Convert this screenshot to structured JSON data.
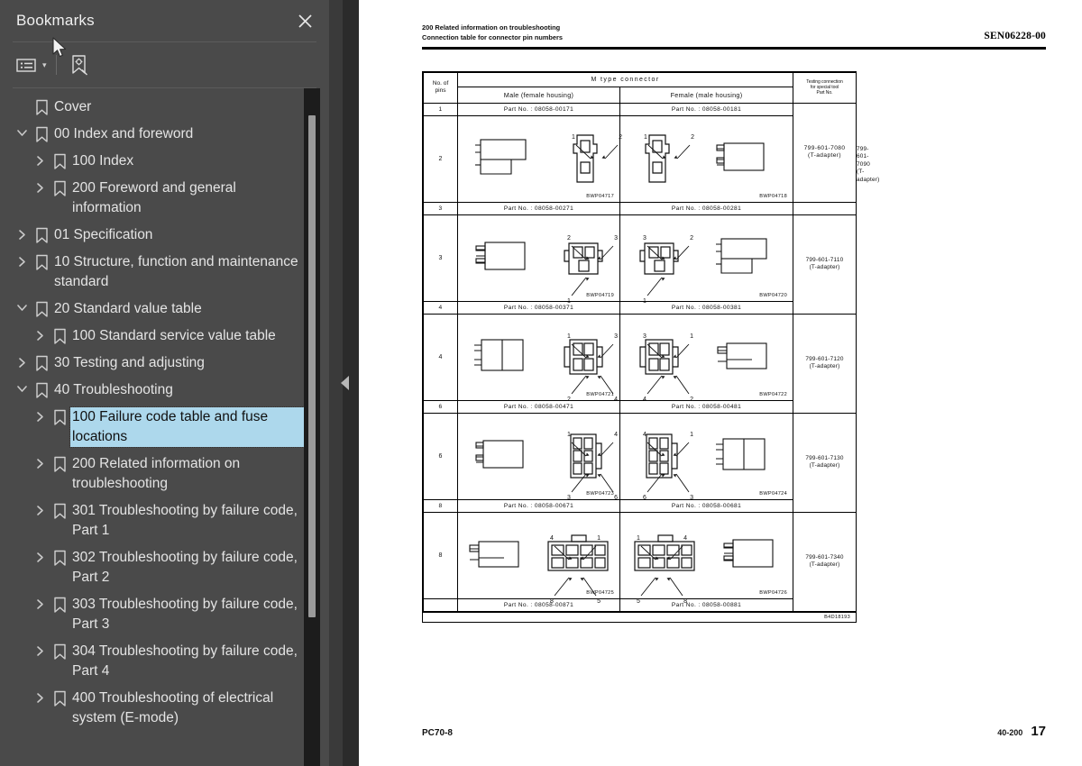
{
  "sidebar": {
    "title": "Bookmarks",
    "close_icon": "close-icon",
    "toolbar": {
      "list_options_icon": "list-options-icon",
      "list_options_caret": "▾",
      "new_bookmark_icon": "new-bookmark-icon"
    },
    "items": [
      {
        "label": "Cover",
        "level": 0,
        "expander": "none",
        "selected": false
      },
      {
        "label": "00 Index and foreword",
        "level": 0,
        "expander": "expanded",
        "selected": false
      },
      {
        "label": "100 Index",
        "level": 1,
        "expander": "collapsed",
        "selected": false
      },
      {
        "label": "200 Foreword and general information",
        "level": 1,
        "expander": "collapsed",
        "selected": false
      },
      {
        "label": "01 Specification",
        "level": 0,
        "expander": "collapsed",
        "selected": false
      },
      {
        "label": "10 Structure, function and maintenance standard",
        "level": 0,
        "expander": "collapsed",
        "selected": false
      },
      {
        "label": "20 Standard value table",
        "level": 0,
        "expander": "expanded",
        "selected": false
      },
      {
        "label": "100 Standard service value table",
        "level": 1,
        "expander": "collapsed",
        "selected": false
      },
      {
        "label": "30 Testing and adjusting",
        "level": 0,
        "expander": "collapsed",
        "selected": false
      },
      {
        "label": "40 Troubleshooting",
        "level": 0,
        "expander": "expanded",
        "selected": false
      },
      {
        "label": "100 Failure code table and fuse locations",
        "level": 1,
        "expander": "collapsed",
        "selected": true
      },
      {
        "label": "200 Related information on troubleshooting",
        "level": 1,
        "expander": "collapsed",
        "selected": false
      },
      {
        "label": "301 Troubleshooting by failure code, Part 1",
        "level": 1,
        "expander": "collapsed",
        "selected": false
      },
      {
        "label": "302 Troubleshooting by failure code, Part 2",
        "level": 1,
        "expander": "collapsed",
        "selected": false
      },
      {
        "label": "303 Troubleshooting by failure code, Part 3",
        "level": 1,
        "expander": "collapsed",
        "selected": false
      },
      {
        "label": "304 Troubleshooting by failure code, Part 4",
        "level": 1,
        "expander": "collapsed",
        "selected": false
      },
      {
        "label": "400 Troubleshooting of electrical system (E-mode)",
        "level": 1,
        "expander": "collapsed",
        "selected": false
      }
    ],
    "scrollbar": {
      "thumb_top_pct": 4,
      "thumb_height_pct": 74
    }
  },
  "divider": {
    "collapse_icon": "collapse-left-icon"
  },
  "document": {
    "header": {
      "line1": "200 Related information on troubleshooting",
      "line2": "Connection table for connector pin numbers",
      "doc_number": "SEN06228-00"
    },
    "table": {
      "headers": {
        "pins": "No. of\npins",
        "connector_type": "M type connector",
        "male": "Male (female housing)",
        "female": "Female (male housing)",
        "tool": "Testing connection\nfor special tool\nPart No."
      },
      "top_part_row": {
        "male": "Part No. : 08058-00171",
        "female": "Part No. : 08058-00181",
        "tool": "799-601-7080\n(T-adapter)"
      },
      "rows": [
        {
          "pins": "2",
          "male_code": "BWP04717",
          "female_code": "BWP04718",
          "tool": "799-601-7090\n(T-adapter)",
          "male_part": "Part No. : 08058-00271",
          "female_part": "Part No. : 08058-00281",
          "male_pin_labels": [
            "1",
            "2"
          ],
          "female_pin_labels": [
            "1",
            "2"
          ]
        },
        {
          "pins": "3",
          "male_code": "BWP04719",
          "female_code": "BWP04720",
          "tool": "799-601-7110\n(T-adapter)",
          "male_part": "Part No. : 08058-00371",
          "female_part": "Part No. : 08058-00381",
          "male_pin_labels": [
            "2",
            "3",
            "1"
          ],
          "female_pin_labels": [
            "3",
            "2",
            "1"
          ]
        },
        {
          "pins": "4",
          "male_code": "BWP04721",
          "female_code": "BWP04722",
          "tool": "799-601-7120\n(T-adapter)",
          "male_part": "Part No. : 08058-00471",
          "female_part": "Part No. : 08058-00481",
          "male_pin_labels": [
            "1",
            "3",
            "2",
            "4"
          ],
          "female_pin_labels": [
            "3",
            "1",
            "4",
            "2"
          ]
        },
        {
          "pins": "6",
          "male_code": "BWP04723",
          "female_code": "BWP04724",
          "tool": "799-601-7130\n(T-adapter)",
          "male_part": "Part No. : 08058-00671",
          "female_part": "Part No. : 08058-00681",
          "male_pin_labels": [
            "1",
            "4",
            "3",
            "6"
          ],
          "female_pin_labels": [
            "4",
            "1",
            "6",
            "3"
          ]
        },
        {
          "pins": "8",
          "male_code": "BWP04725",
          "female_code": "BWP04726",
          "tool": "799-601-7340\n(T-adapter)",
          "male_part": "Part No. : 08058-00871",
          "female_part": "Part No. : 08058-00881",
          "male_pin_labels": [
            "4",
            "1",
            "8",
            "5"
          ],
          "female_pin_labels": [
            "1",
            "4",
            "5",
            "8"
          ]
        }
      ],
      "footer_code": "B4D18193"
    },
    "footer": {
      "model": "PC70-8",
      "section": "40-200",
      "page": "17"
    }
  }
}
